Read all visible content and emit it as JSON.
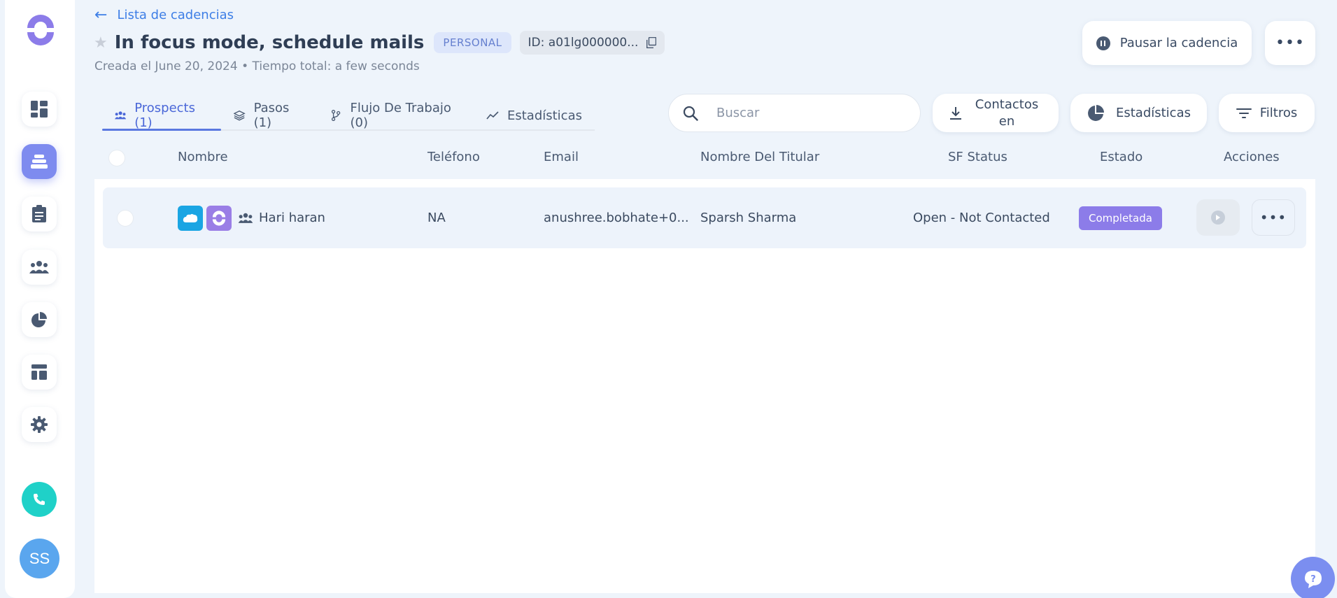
{
  "header": {
    "back_label": "Lista de cadencias",
    "title": "In focus mode, schedule mails",
    "type_badge": "PERSONAL",
    "id_label": "ID: a01lg000000...",
    "subtitle": "Creada el June 20, 2024 • Tiempo total: a few seconds",
    "pause_label": "Pausar la cadencia",
    "more_label": "•••"
  },
  "tabs": [
    {
      "label": "Prospects (1)",
      "icon": "people-icon",
      "active": true
    },
    {
      "label": "Pasos (1)",
      "icon": "layers-icon",
      "active": false
    },
    {
      "label": "Flujo De Trabajo (0)",
      "icon": "workflow-icon",
      "active": false
    },
    {
      "label": "Estadísticas",
      "icon": "trend-icon",
      "active": false
    }
  ],
  "toolbar": {
    "search_placeholder": "Buscar",
    "contacts_label": "Contactos en",
    "stats_label": "Estadísticas",
    "filters_label": "Filtros"
  },
  "table": {
    "columns": [
      "Nombre",
      "Teléfono",
      "Email",
      "Nombre Del Titular",
      "SF Status",
      "Estado",
      "Acciones"
    ],
    "rows": [
      {
        "name": "Hari haran",
        "phone": "NA",
        "email": "anushree.bobhate+0...",
        "owner": "Sparsh Sharma",
        "sf_status": "Open - Not Contacted",
        "status": "Completada",
        "more": "•••"
      }
    ]
  },
  "sidebar": {
    "avatar_initials": "SS",
    "items": [
      "dashboard-icon",
      "cadence-icon",
      "tasks-icon",
      "people-icon",
      "pie-chart-icon",
      "template-icon",
      "settings-icon"
    ]
  },
  "colors": {
    "accent": "#5a78e0",
    "status_completed": "#8c7ce9",
    "salesforce": "#1aa5e3",
    "phone": "#1fd1c8",
    "avatar": "#5aa6ee"
  }
}
